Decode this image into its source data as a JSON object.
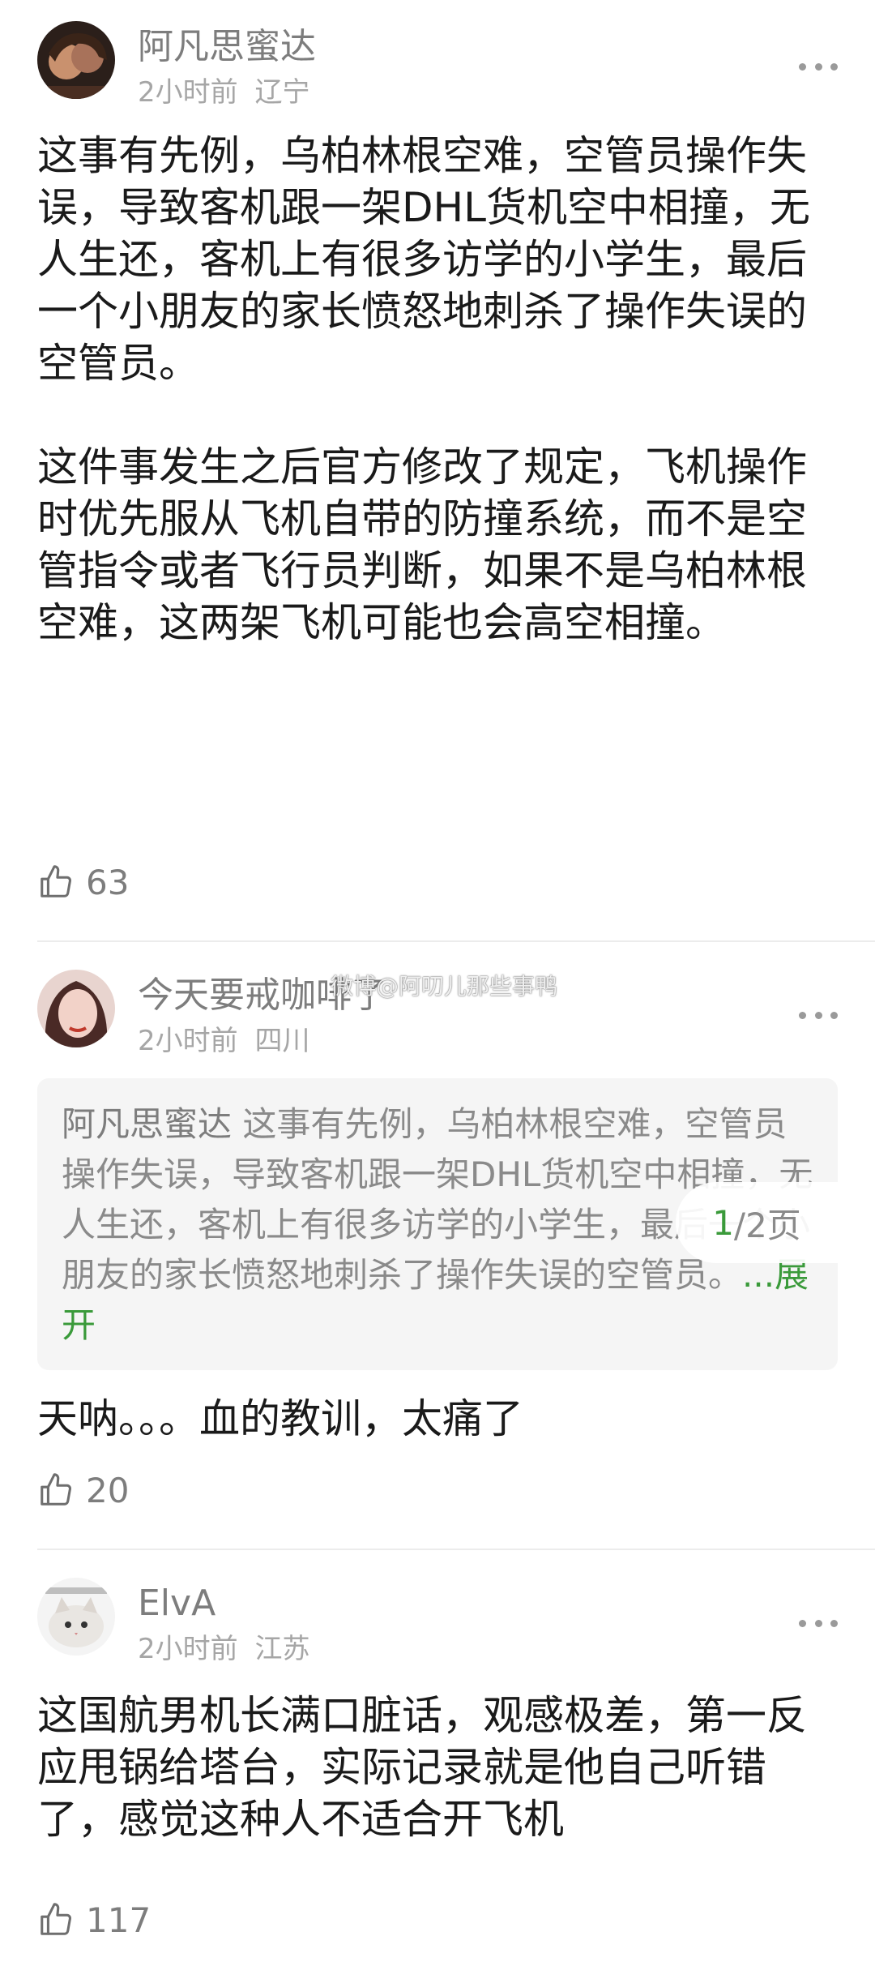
{
  "comments": [
    {
      "username": "阿凡思蜜达",
      "time": "2小时前",
      "location": "辽宁",
      "text": "这事有先例，乌柏林根空难，空管员操作失误，导致客机跟一架DHL货机空中相撞，无人生还，客机上有很多访学的小学生，最后一个小朋友的家长愤怒地刺杀了操作失误的空管员。\n\n这件事发生之后官方修改了规定，飞机操作时优先服从飞机自带的防撞系统，而不是空管指令或者飞行员判断，如果不是乌柏林根空难，这两架飞机可能也会高空相撞。",
      "likes": "63"
    },
    {
      "username": "今天要戒咖啡了",
      "time": "2小时前",
      "location": "四川",
      "quote": {
        "author": "阿凡思蜜达",
        "text": "这事有先例，乌柏林根空难，空管员操作失误，导致客机跟一架DHL货机空中相撞，无人生还，客机上有很多访学的小学生，最后一个小朋友的家长愤怒地刺杀了操作失误的空管员。",
        "expand": "...展开"
      },
      "text": "天呐。。。血的教训，太痛了",
      "likes": "20"
    },
    {
      "username": "ElvA",
      "time": "2小时前",
      "location": "江苏",
      "text": "这国航男机长满口脏话，观感极差，第一反应甩锅给塔台，实际记录就是他自己听错了，感觉这种人不适合开飞机",
      "likes": "117"
    }
  ],
  "pager": {
    "current": "1",
    "total": "/2页"
  },
  "watermark": "微博@阿叨儿那些事鸭",
  "colors": {
    "accent": "#3a9a3a",
    "meta": "#a6a6a6",
    "quote_bg": "#f5f5f5"
  },
  "icons": [
    "thumbs-up-icon",
    "more-icon",
    "avatar"
  ]
}
